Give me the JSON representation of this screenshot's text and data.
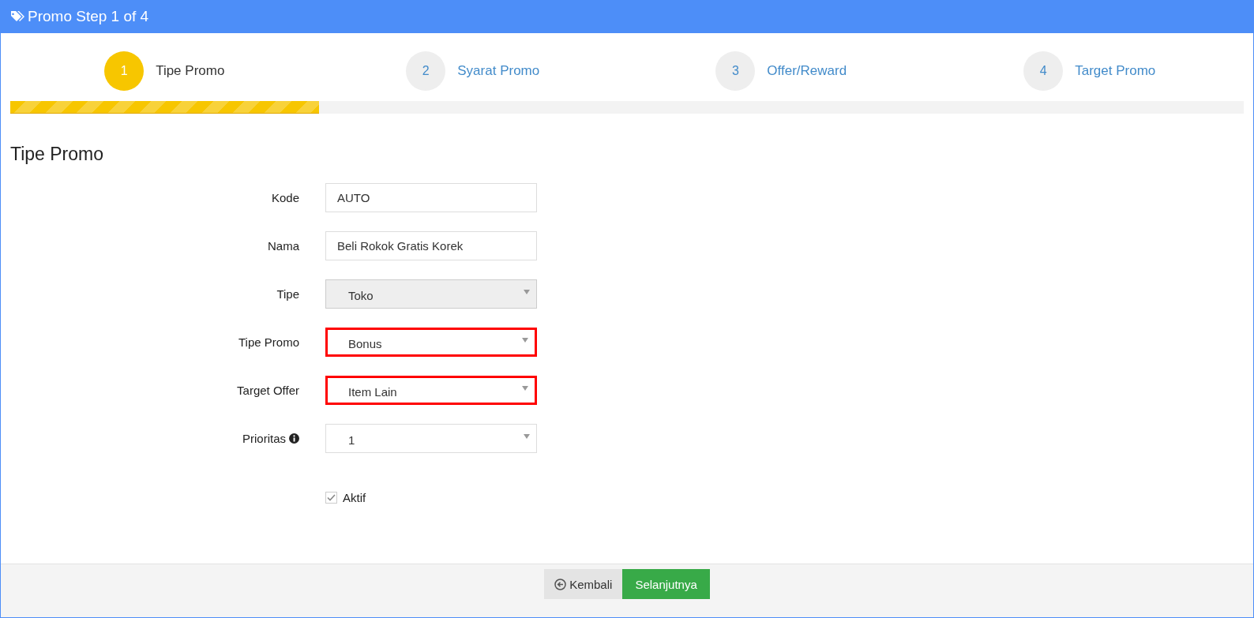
{
  "window": {
    "title": "Promo Step 1 of 4"
  },
  "steps": [
    {
      "number": "1",
      "label": "Tipe Promo",
      "selected": true
    },
    {
      "number": "2",
      "label": "Syarat Promo",
      "selected": false
    },
    {
      "number": "3",
      "label": "Offer/Reward",
      "selected": false
    },
    {
      "number": "4",
      "label": "Target Promo",
      "selected": false
    }
  ],
  "progress": {
    "level": 0.25
  },
  "section": {
    "title": "Tipe Promo"
  },
  "fields": [
    {
      "label": "Kode",
      "kind": "text",
      "value": "AUTO",
      "disabled": false,
      "highlighted": false,
      "info": false
    },
    {
      "label": "Nama",
      "kind": "text",
      "value": "Beli Rokok Gratis Korek",
      "disabled": false,
      "highlighted": false,
      "info": false
    },
    {
      "label": "Tipe",
      "kind": "select",
      "value": "Toko",
      "disabled": true,
      "highlighted": false,
      "info": false
    },
    {
      "label": "Tipe Promo",
      "kind": "select",
      "value": "Bonus",
      "disabled": false,
      "highlighted": true,
      "info": false
    },
    {
      "label": "Target Offer",
      "kind": "select",
      "value": "Item Lain",
      "disabled": false,
      "highlighted": true,
      "info": false
    },
    {
      "label": "Prioritas",
      "kind": "select",
      "value": "1",
      "disabled": false,
      "highlighted": false,
      "info": true
    }
  ],
  "checkbox": {
    "label": "Aktif",
    "checked": true
  },
  "buttons": [
    {
      "label": "Kembali",
      "kind": "back"
    },
    {
      "label": "Selanjutnya",
      "kind": "next"
    }
  ]
}
